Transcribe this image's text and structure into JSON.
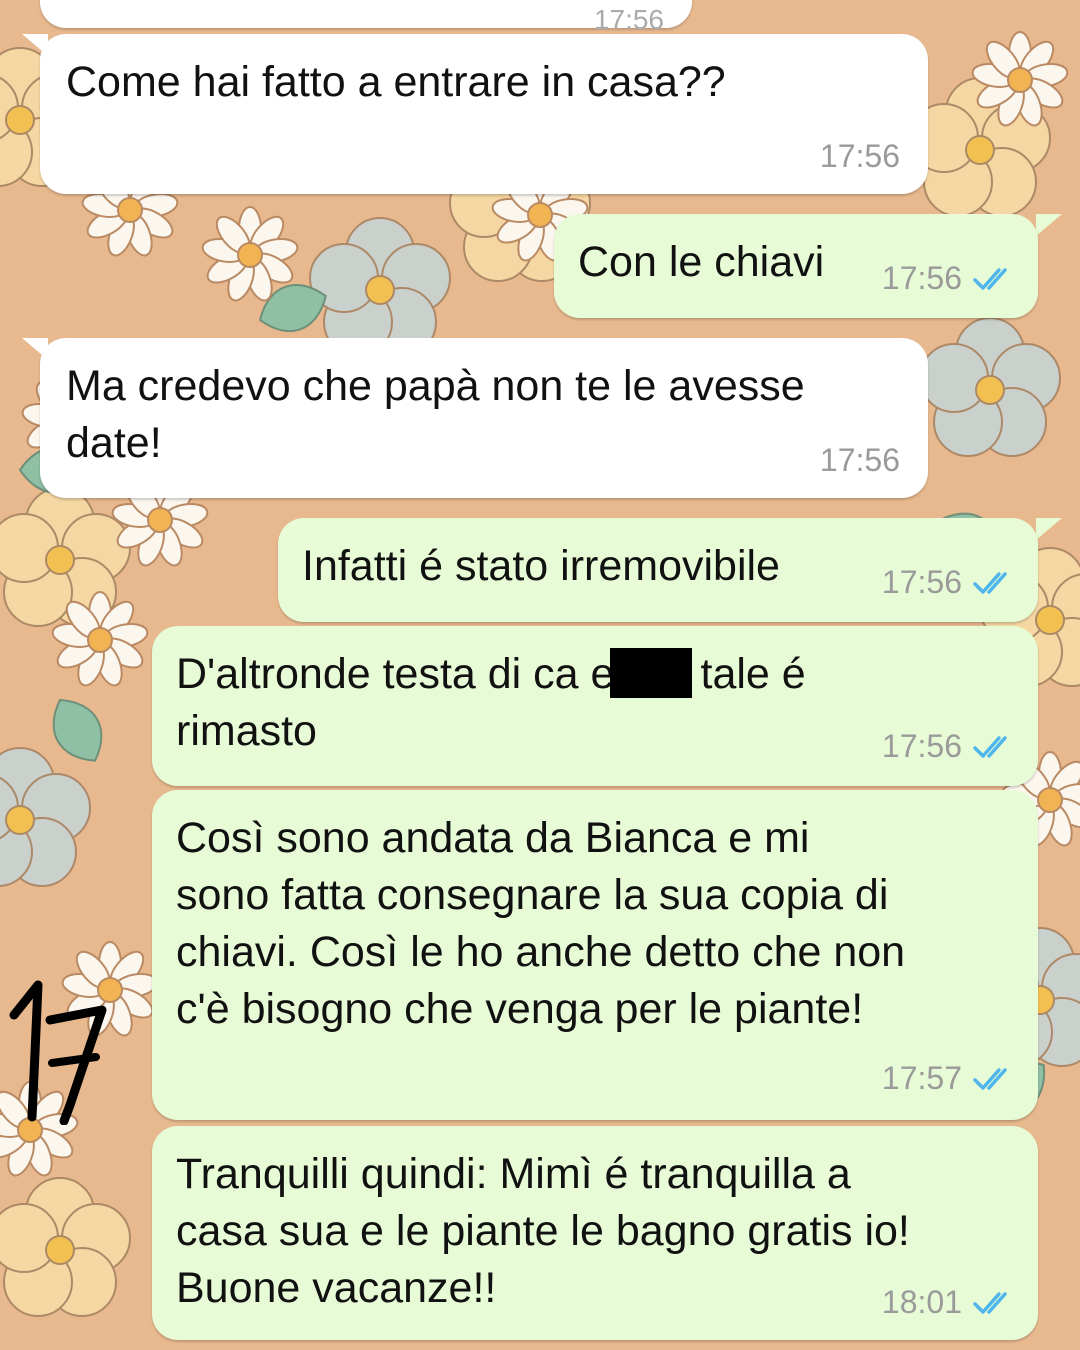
{
  "chat": {
    "top_partial_time": "17:56",
    "messages": [
      {
        "direction": "incoming",
        "text": "Come hai fatto a entrare in casa??",
        "time": "17:56"
      },
      {
        "direction": "outgoing",
        "text": "Con le chiavi",
        "time": "17:56",
        "status": "read"
      },
      {
        "direction": "incoming",
        "text": "Ma credevo che papà non te le avesse\ndate!",
        "time": "17:56"
      },
      {
        "direction": "outgoing",
        "text": "Infatti é stato irremovibile",
        "time": "17:56",
        "status": "read"
      },
      {
        "direction": "outgoing",
        "text": "D'altronde testa di ca      era e tale é\nrimasto",
        "time": "17:56",
        "status": "read",
        "redacted": true
      },
      {
        "direction": "outgoing",
        "text": "Così sono andata da Bianca e mi\nsono fatta consegnare la sua copia di\nchiavi. Così le ho anche detto che non\nc'è bisogno che venga per le piante!",
        "time": "17:57",
        "status": "read"
      },
      {
        "direction": "outgoing",
        "text": "Tranquilli quindi: Mimì é tranquilla a\ncasa sua e le piante le bagno gratis io!\nBuone vacanze!!",
        "time": "18:01",
        "status": "read"
      }
    ]
  },
  "annotation": {
    "handwritten_number": "17"
  },
  "icons": {
    "read_receipt": "double-check-icon"
  },
  "colors": {
    "incoming_bubble": "#ffffff",
    "outgoing_bubble": "#e7fcd6",
    "read_ticks": "#4fb6ec",
    "timestamp": "#9a9a9a",
    "wallpaper_base": "#e8b98f"
  }
}
